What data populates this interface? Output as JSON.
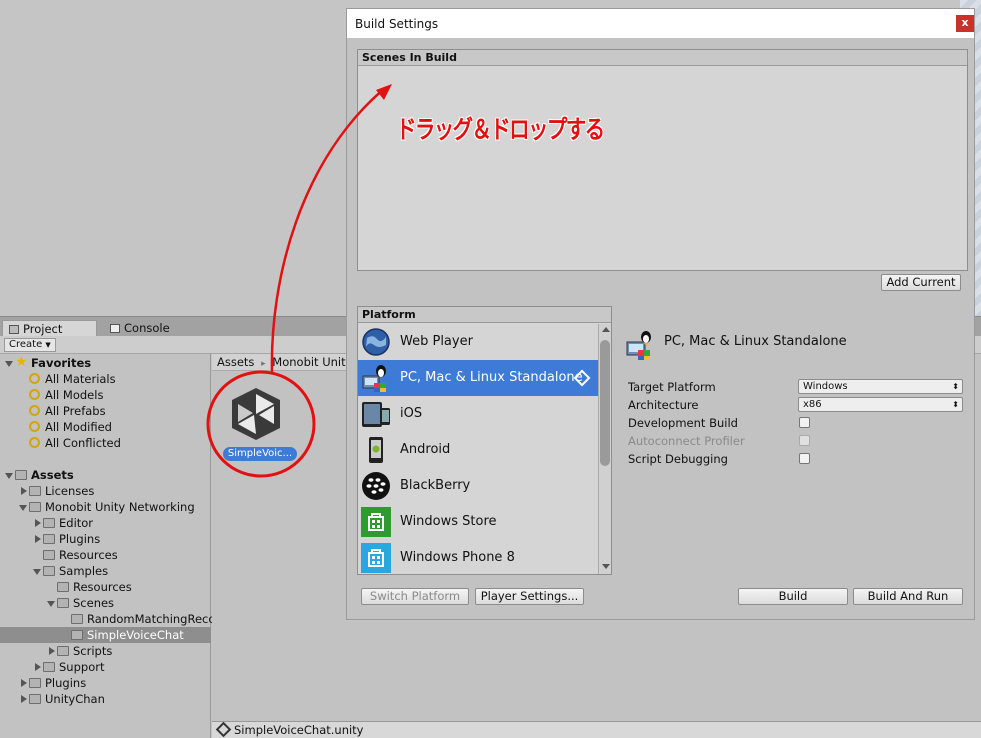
{
  "project": {
    "tabs": [
      {
        "label": "Project",
        "active": true
      },
      {
        "label": "Console",
        "active": false
      }
    ],
    "create_label": "Create",
    "tree": [
      {
        "label": "Favorites",
        "kind": "star",
        "depth": 0,
        "expanded": true,
        "bold": true
      },
      {
        "label": "All Materials",
        "kind": "search",
        "depth": 1
      },
      {
        "label": "All Models",
        "kind": "search",
        "depth": 1
      },
      {
        "label": "All Prefabs",
        "kind": "search",
        "depth": 1
      },
      {
        "label": "All Modified",
        "kind": "search",
        "depth": 1
      },
      {
        "label": "All Conflicted",
        "kind": "search",
        "depth": 1
      },
      {
        "label": "",
        "kind": "spacer",
        "depth": 0
      },
      {
        "label": "Assets",
        "kind": "folder",
        "depth": 0,
        "expanded": true,
        "bold": true
      },
      {
        "label": "Licenses",
        "kind": "folder",
        "depth": 1,
        "expanded": false
      },
      {
        "label": "Monobit Unity Networking",
        "kind": "folder",
        "depth": 1,
        "expanded": true
      },
      {
        "label": "Editor",
        "kind": "folder",
        "depth": 2,
        "expanded": false
      },
      {
        "label": "Plugins",
        "kind": "folder",
        "depth": 2,
        "expanded": false
      },
      {
        "label": "Resources",
        "kind": "folder",
        "depth": 2,
        "leaf": true
      },
      {
        "label": "Samples",
        "kind": "folder",
        "depth": 2,
        "expanded": true
      },
      {
        "label": "Resources",
        "kind": "folder",
        "depth": 3,
        "leaf": true
      },
      {
        "label": "Scenes",
        "kind": "folder",
        "depth": 3,
        "expanded": true
      },
      {
        "label": "RandomMatchingReco",
        "kind": "folder",
        "depth": 4,
        "leaf": true
      },
      {
        "label": "SimpleVoiceChat",
        "kind": "folder",
        "depth": 4,
        "leaf": true,
        "selected": true
      },
      {
        "label": "Scripts",
        "kind": "folder",
        "depth": 3,
        "expanded": false
      },
      {
        "label": "Support",
        "kind": "folder",
        "depth": 2,
        "expanded": false
      },
      {
        "label": "Plugins",
        "kind": "folder",
        "depth": 1,
        "expanded": false
      },
      {
        "label": "UnityChan",
        "kind": "folder",
        "depth": 1,
        "expanded": false
      }
    ],
    "breadcrumb": [
      "Assets",
      "Monobit Unity"
    ],
    "breadcrumb_sep": "▸",
    "asset_label": "SimpleVoic...",
    "status_file": "SimpleVoiceChat.unity"
  },
  "build_settings": {
    "title": "Build Settings",
    "close_label": "x",
    "scenes_header": "Scenes In Build",
    "annotation": "ドラッグ＆ドロップする",
    "add_current_label": "Add Current",
    "platform_header": "Platform",
    "platforms": [
      {
        "label": "Web Player",
        "icon": "globe-icon"
      },
      {
        "label": "PC, Mac & Linux Standalone",
        "icon": "standalone-icon",
        "selected": true
      },
      {
        "label": "iOS",
        "icon": "ios-icon"
      },
      {
        "label": "Android",
        "icon": "android-icon"
      },
      {
        "label": "BlackBerry",
        "icon": "blackberry-icon"
      },
      {
        "label": "Windows Store",
        "icon": "windows-store-icon"
      },
      {
        "label": "Windows Phone 8",
        "icon": "windows-phone-icon"
      }
    ],
    "selected_platform_title": "PC, Mac & Linux Standalone",
    "settings": {
      "target_platform_label": "Target Platform",
      "target_platform_value": "Windows",
      "architecture_label": "Architecture",
      "architecture_value": "x86",
      "development_build_label": "Development Build",
      "autoconnect_profiler_label": "Autoconnect Profiler",
      "script_debugging_label": "Script Debugging"
    },
    "switch_platform_label": "Switch Platform",
    "player_settings_label": "Player Settings...",
    "build_label": "Build",
    "build_and_run_label": "Build And Run"
  },
  "colors": {
    "selection_blue": "#3d7bd6",
    "annotation_red": "#e21010"
  }
}
